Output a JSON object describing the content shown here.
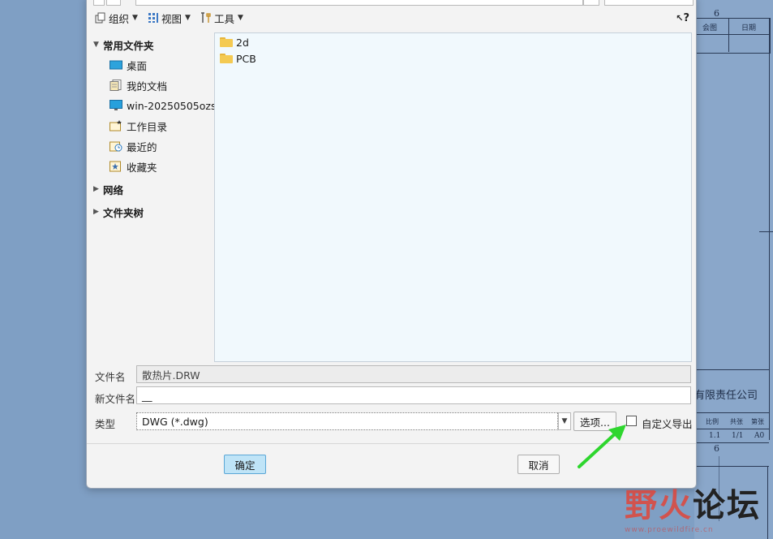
{
  "toolbar": {
    "organize": "组织",
    "views": "视图",
    "tools": "工具",
    "help_symbol": "?"
  },
  "nav": {
    "favorites_group": "常用文件夹",
    "items": [
      {
        "label": "桌面",
        "icon": "desktop-icon"
      },
      {
        "label": "我的文档",
        "icon": "documents-icon"
      },
      {
        "label": "win-20250505ozs",
        "icon": "computer-icon"
      },
      {
        "label": "工作目录",
        "icon": "working-dir-icon"
      },
      {
        "label": "最近的",
        "icon": "recent-icon"
      },
      {
        "label": "收藏夹",
        "icon": "favorites-icon"
      }
    ],
    "network_group": "网络",
    "folder_tree_group": "文件夹树"
  },
  "files": [
    {
      "name": "2d",
      "icon": "folder-icon"
    },
    {
      "name": "PCB",
      "icon": "folder-icon"
    }
  ],
  "form": {
    "filename_label": "文件名",
    "filename_value": "散热片.DRW",
    "new_filename_label": "新文件名",
    "new_filename_value": "__",
    "type_label": "类型",
    "type_value": "DWG (*.dwg)",
    "options_button": "选项...",
    "custom_export_label": "自定义导出"
  },
  "buttons": {
    "ok": "确定",
    "cancel": "取消"
  },
  "background_drawing": {
    "sheet_number_top": "6",
    "header_cell_1": "会图",
    "header_cell_2": "日期",
    "company_text": "有限责任公司",
    "cell_a": "1.1",
    "cell_b": "1/1",
    "cell_c": "A0",
    "row_labels": [
      "比例",
      "共张",
      "第张"
    ],
    "sheet_number_bottom": "6"
  },
  "watermark": {
    "text_part1": "野火",
    "text_part2": "论坛",
    "sub": "www.proewildfire.cn"
  },
  "colors": {
    "dialog_bg": "#f3f3f3",
    "filelist_bg": "#f1f9fd",
    "ok_button_bg": "#bfe4f7",
    "arrow": "#2ed62e",
    "desktop_bg": "#7f9fc4"
  }
}
